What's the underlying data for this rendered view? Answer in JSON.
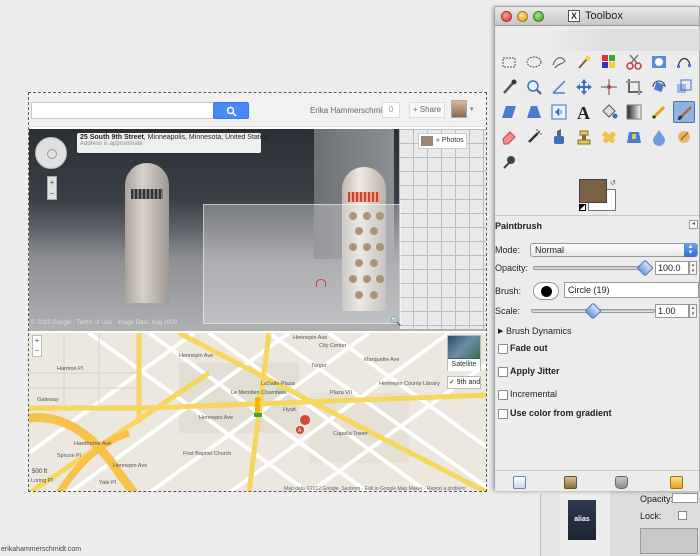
{
  "google_bar": {
    "user_name": "Erika Hammerschmidt",
    "notifications_count": "0",
    "share_label": "+ Share"
  },
  "street_view": {
    "address_bold": "25 South 9th Street",
    "address_rest": ", Minneapolis, Minnesota, United States",
    "address_note": "Address is approximate",
    "photos_label": "« Photos",
    "close_label": "×",
    "copyright": "© 2012 Google · Terms of Use · Image Date: Aug 2009",
    "zoom_plus": "+",
    "zoom_minus": "−"
  },
  "map": {
    "satellite_label": "Satellite",
    "ninth_label": "✓ 9th and",
    "zoom_plus": "+",
    "zoom_minus": "−",
    "scale_label": "500 ft",
    "copyright": "Map data ©2012 Google, Sanborn · Edit in Google Map Maker · Report a problem",
    "labels": {
      "hennepin1": "Hennepin Ave",
      "hennepin2": "Hennepin Ave",
      "hennepin3": "Hennepin Ave",
      "hennepin4": "Hennepin Ave",
      "harmon": "Harmon Pl",
      "hawthorne": "Hawthorne Ave",
      "spruce": "Spruce Pl",
      "yale": "Yale Pl",
      "gateway": "Gateway",
      "loring": "Loring Pl",
      "city_center": "City Center",
      "capella": "Capella Tower",
      "marquette": "Marquette Ave",
      "target": "Target",
      "first_baptist": "First Baptist Church",
      "plaza": "Plaza VII",
      "lasalle": "LaSalle Plaza",
      "hyatt": "Hyatt",
      "la_meridien": "Le Meridien Chambers",
      "hennepin_county": "Hennepin County Library"
    }
  },
  "footer_url": "erikahammerschmidt.com",
  "toolbox": {
    "title": "Toolbox",
    "options_title": "Paintbrush",
    "mode_label": "Mode:",
    "mode_value": "Normal",
    "opacity_label": "Opacity:",
    "opacity_value": "100.0",
    "opacity_fraction": 1.0,
    "brush_label": "Brush:",
    "brush_value": "Circle (19)",
    "scale_label": "Scale:",
    "scale_value": "1.00",
    "scale_fraction": 0.5,
    "brush_dynamics": "Brush Dynamics",
    "options": [
      {
        "label": "Fade out",
        "bold": true
      },
      {
        "label": "Apply Jitter",
        "bold": true
      },
      {
        "label": "Incremental",
        "bold": false
      },
      {
        "label": "Use color from gradient",
        "bold": true
      }
    ],
    "fg_color": "#7a6146",
    "bg_color": "#ffffff"
  },
  "layers_dock": {
    "opacity_label": "Opacity:",
    "lock_label": "Lock:",
    "alias_label": "alias"
  }
}
